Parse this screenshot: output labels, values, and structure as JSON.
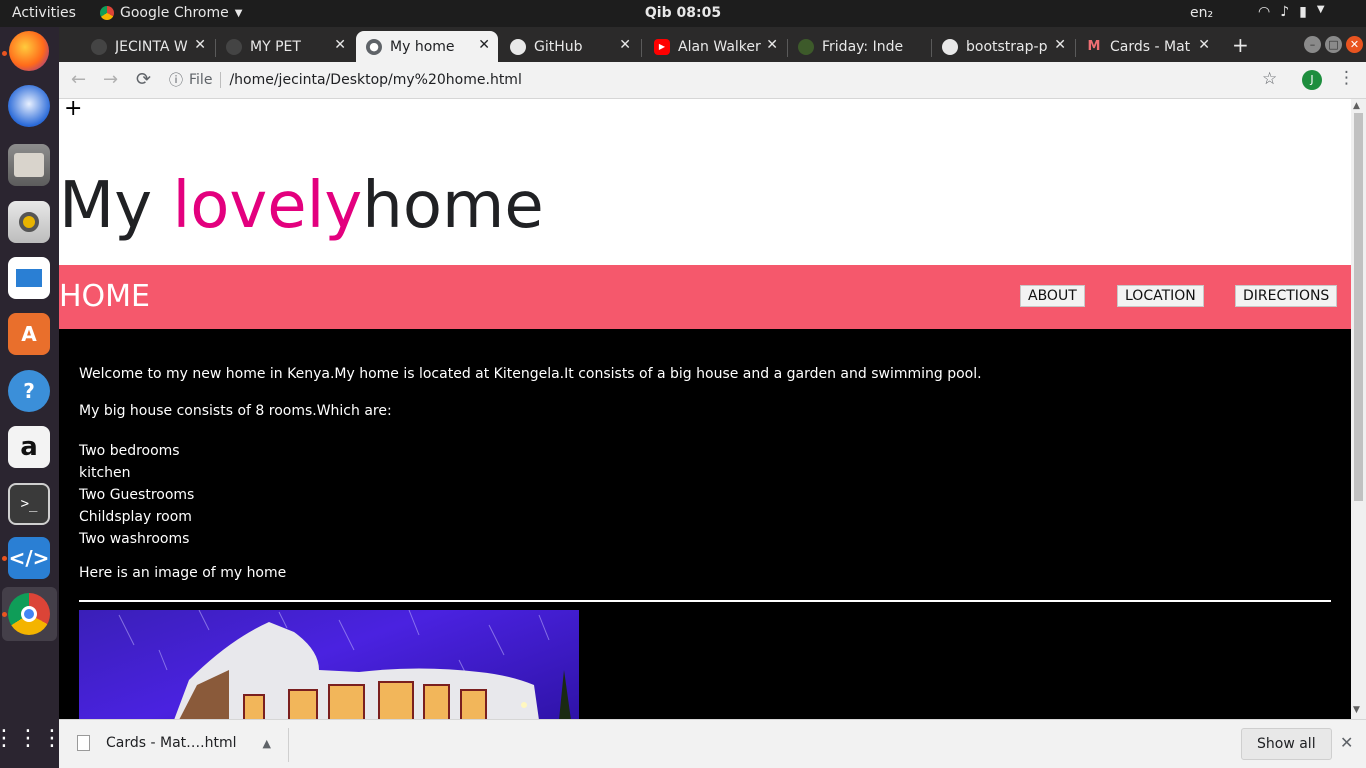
{
  "topbar": {
    "activities": "Activities",
    "app_name": "Google Chrome",
    "clock": "Qib 08:05",
    "lang": "en₂"
  },
  "dock": {
    "items": [
      "firefox-icon",
      "thunderbird-icon",
      "files-icon",
      "rhythmbox-icon",
      "libreoffice-writer-icon",
      "software-center-icon",
      "help-icon",
      "amazon-icon",
      "terminal-icon",
      "vscode-icon",
      "chrome-icon",
      "show-apps-icon"
    ]
  },
  "tabs": [
    {
      "label": "JECINTA W",
      "active": false
    },
    {
      "label": "MY PET",
      "active": false
    },
    {
      "label": "My home",
      "active": true
    },
    {
      "label": "GitHub",
      "active": false
    },
    {
      "label": "Alan Walker",
      "active": false
    },
    {
      "label": "Friday: Inde",
      "active": false
    },
    {
      "label": "bootstrap-p",
      "active": false
    },
    {
      "label": "Cards - Mat",
      "active": false
    }
  ],
  "address": {
    "protocol": "File",
    "url": "/home/jecinta/Desktop/my%20home.html",
    "profile_initial": "J"
  },
  "page": {
    "plus": "+",
    "title_part1": "My ",
    "title_accent": "lovely",
    "title_part2": "home",
    "accent_color": "#e3007e",
    "nav_home": "HOME",
    "nav_links": [
      "ABOUT",
      "LOCATION",
      "DIRECTIONS"
    ],
    "nav_color": "#f5586c",
    "intro": "Welcome to my new home in Kenya.My home is located at Kitengela.It consists of a big house and a garden and swimming pool.",
    "rooms_intro": "My big house consists of 8 rooms.Which are:",
    "rooms": [
      "Two bedrooms",
      "kitchen",
      "Two Guestrooms",
      "Childsplay room",
      "Two washrooms"
    ],
    "image_caption": "Here is an image of my home"
  },
  "downloads": {
    "file": "Cards - Mat….html",
    "show_all": "Show all"
  }
}
